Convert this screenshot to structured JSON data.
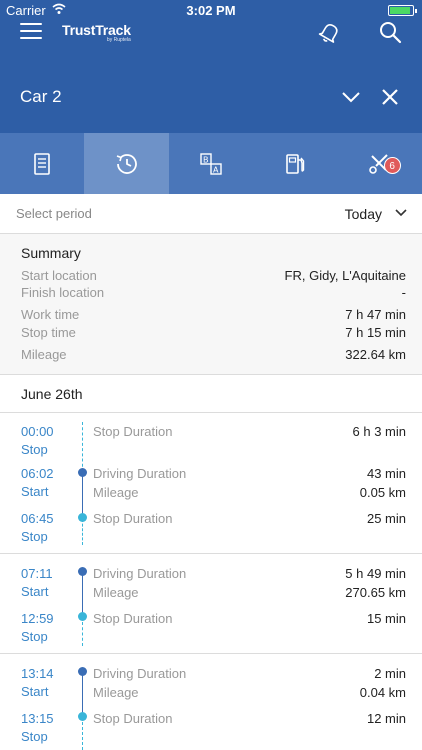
{
  "statusbar": {
    "carrier": "Carrier",
    "time": "3:02 PM"
  },
  "header": {
    "logo": "TrustTrack",
    "logo_sub": "by Ruptela",
    "vehicle": "Car 2"
  },
  "tabs": [
    {
      "name": "document",
      "icon": "document-icon"
    },
    {
      "name": "history",
      "icon": "history-clock-icon",
      "active": true
    },
    {
      "name": "route",
      "icon": "route-ab-icon"
    },
    {
      "name": "fuel",
      "icon": "fuel-pump-icon"
    },
    {
      "name": "maintenance",
      "icon": "wrench-screwdriver-icon",
      "badge": "6"
    }
  ],
  "period": {
    "label": "Select period",
    "value": "Today"
  },
  "summary": {
    "title": "Summary",
    "rows": [
      {
        "key": "Start location",
        "value": "FR, Gidy, L'Aquitaine"
      },
      {
        "key": "Finish location",
        "value": "-"
      },
      {
        "key": "Work time",
        "value": "7 h 47 min"
      },
      {
        "key": "Stop time",
        "value": "7 h 15 min"
      },
      {
        "key": "Mileage",
        "value": "322.64 km"
      }
    ]
  },
  "date": "June 26th",
  "events": {
    "g1": {
      "e1": {
        "time": "00:00",
        "type": "Stop",
        "label": "Stop Duration",
        "value": "6 h 3 min"
      },
      "e2": {
        "time": "06:02",
        "type": "Start",
        "label": "Driving Duration",
        "value": "43 min",
        "label2": "Mileage",
        "value2": "0.05 km"
      },
      "e3": {
        "time": "06:45",
        "type": "Stop",
        "label": "Stop Duration",
        "value": "25 min"
      }
    },
    "g2": {
      "e1": {
        "time": "07:11",
        "type": "Start",
        "label": "Driving Duration",
        "value": "5 h 49 min",
        "label2": "Mileage",
        "value2": "270.65 km"
      },
      "e2": {
        "time": "12:59",
        "type": "Stop",
        "label": "Stop Duration",
        "value": "15 min"
      }
    },
    "g3": {
      "e1": {
        "time": "13:14",
        "type": "Start",
        "label": "Driving Duration",
        "value": "2 min",
        "label2": "Mileage",
        "value2": "0.04 km"
      },
      "e2": {
        "time": "13:15",
        "type": "Stop",
        "label": "Stop Duration",
        "value": "12 min"
      }
    }
  },
  "colors": {
    "header": "#2e5ea6",
    "tabs": "#4a76b9",
    "tab_active": "#6e92c8",
    "drive": "#3a6db5",
    "stop": "#39b5d9",
    "badge": "#e05a5a"
  }
}
